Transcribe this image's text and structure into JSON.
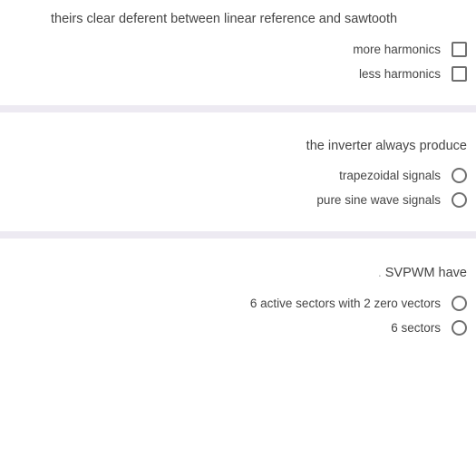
{
  "questions": [
    {
      "prompt": "theirs clear deferent between linear  reference and sawtooth",
      "type": "checkbox",
      "options": [
        {
          "label": "more harmonics"
        },
        {
          "label": "less harmonics"
        }
      ]
    },
    {
      "prompt": "the inverter always produce",
      "type": "radio",
      "options": [
        {
          "label": "trapezoidal signals"
        },
        {
          "label": "pure sine wave signals"
        }
      ]
    },
    {
      "prompt": "SVPWM have",
      "type": "radio",
      "options": [
        {
          "label": "6 active sectors with 2 zero vectors"
        },
        {
          "label": "6 sectors"
        }
      ]
    }
  ]
}
